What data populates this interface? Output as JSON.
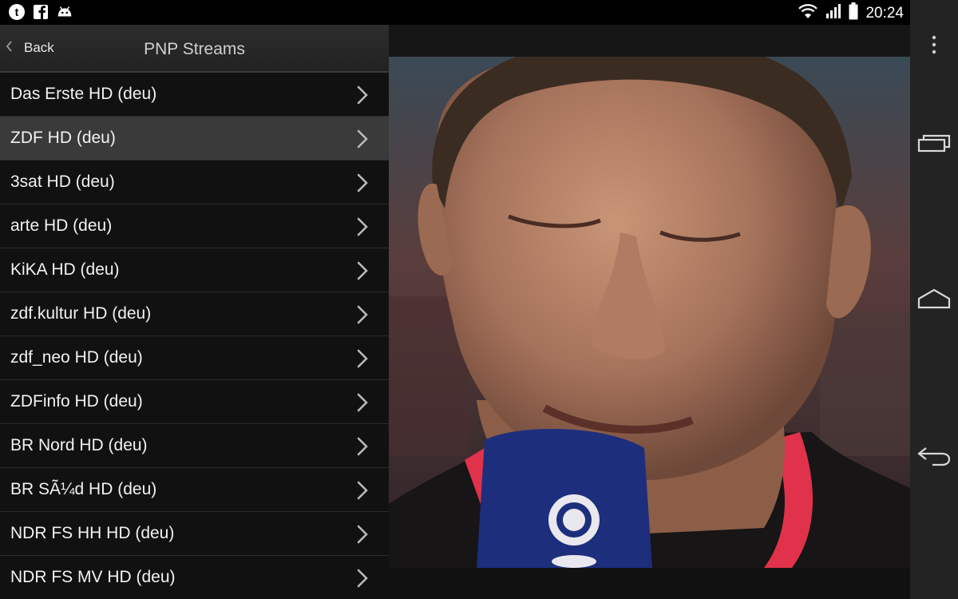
{
  "status_bar": {
    "clock": "20:24",
    "left_icons": [
      "tapatalk-icon",
      "facebook-icon",
      "android-debug-icon"
    ],
    "right_icons": [
      "wifi-icon",
      "cell-signal-icon",
      "battery-icon"
    ]
  },
  "action_bar": {
    "back_label": "Back",
    "title": "PNP Streams"
  },
  "streams": [
    {
      "label": "Das Erste HD (deu)"
    },
    {
      "label": "ZDF HD (deu)",
      "selected": true
    },
    {
      "label": "3sat HD (deu)"
    },
    {
      "label": "arte HD (deu)"
    },
    {
      "label": "KiKA HD (deu)"
    },
    {
      "label": "zdf.kultur HD (deu)"
    },
    {
      "label": "zdf_neo HD (deu)"
    },
    {
      "label": "ZDFinfo HD (deu)"
    },
    {
      "label": "BR Nord HD (deu)"
    },
    {
      "label": "BR SÃ¼d HD (deu)"
    },
    {
      "label": "NDR FS HH HD (deu)"
    },
    {
      "label": "NDR FS MV HD (deu)"
    }
  ],
  "nav_bar": {
    "icons": [
      "overflow-menu-icon",
      "recent-apps-icon",
      "home-icon",
      "back-nav-icon"
    ]
  },
  "colors": {
    "list_bg": "#111111",
    "selected_row_bg": "#3a3a3a",
    "nav_bg": "#232323"
  }
}
